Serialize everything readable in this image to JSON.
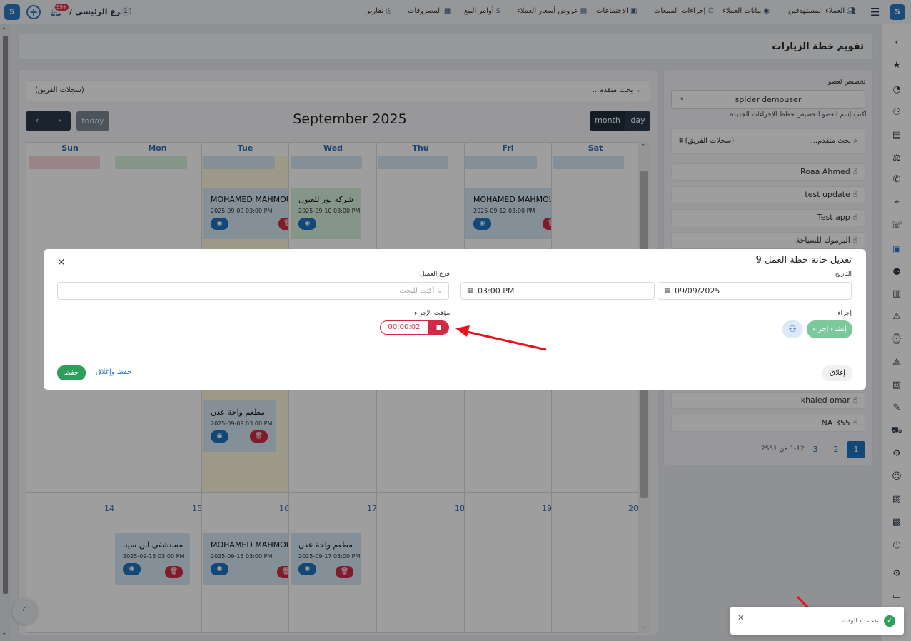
{
  "topbar": {
    "branch_label": "الفرع الرئيسي /",
    "branch_badge": "1",
    "notif_count": "99+",
    "nav": [
      {
        "label": "العملاء المستهدفين",
        "icon": "people-target-icon"
      },
      {
        "label": "بيانات العملاء",
        "icon": "customer-data-icon"
      },
      {
        "label": "إجراءات المبيعات",
        "icon": "phone-icon"
      },
      {
        "label": "الإجتماعات",
        "icon": "meeting-icon"
      },
      {
        "label": "عروض أسعار العملاء",
        "icon": "quote-icon"
      },
      {
        "label": "أوامر البيع",
        "icon": "sales-order-icon"
      },
      {
        "label": "المصروفات",
        "icon": "expenses-icon"
      },
      {
        "label": "تقارير",
        "icon": "reports-icon"
      }
    ]
  },
  "page": {
    "title": "تقويم خطة الزيارات"
  },
  "calendar": {
    "advanced_search": "بحث متقدم...",
    "team_records": "(سجلات الفريق)",
    "title": "September 2025",
    "today_label": "today",
    "month_label": "month",
    "day_label": "day",
    "weekdays": [
      "Sun",
      "Mon",
      "Tue",
      "Wed",
      "Thu",
      "Fri",
      "Sat"
    ],
    "week3_days": [
      "14",
      "15",
      "16",
      "17",
      "18",
      "19",
      "20"
    ],
    "events": [
      {
        "title": "MOHAMED MAHMOUD",
        "time": "2025-09-09 03:00 PM"
      },
      {
        "title": "شركة نور للعيون",
        "time": "2025-09-10 03:00 PM"
      },
      {
        "title": "MOHAMED MAHMOUD",
        "time": "2025-09-12 03:00 PM"
      },
      {
        "title": "مطعم واحة عدن",
        "time": "2025-09-09 03:00 PM"
      },
      {
        "title": "مستشفى ابن سينا",
        "time": "2025-09-15 03:00 PM"
      },
      {
        "title": "MOHAMED MAHMOUD",
        "time": "2025-09-16 03:00 PM"
      },
      {
        "title": "مطعم واحة عدن",
        "time": "2025-09-17 03:00 PM"
      }
    ]
  },
  "side": {
    "assign_label": "تخصيص لعضو",
    "member_value": "spider demouser",
    "hint": "أكتب إسم العضو لتخصيص خطط الإجراءات الجديدة",
    "advanced_search": "بحث متقدم...",
    "team_records": "(سجلات الفريق)",
    "members": [
      "Roaa Ahmed",
      "test update",
      "Test app",
      "اليرموك للسياحة",
      "khaled omar",
      "NA 355"
    ],
    "pager": {
      "p1": "1",
      "p2": "2",
      "p3": "3",
      "info": "1-12 من 2551"
    }
  },
  "modal": {
    "title": "تعديل خانة خطة العمل 9",
    "date_label": "التاريخ",
    "date_value": "09/09/2025",
    "time_value": "03:00 PM",
    "branch_label": "فرع العميل",
    "branch_placeholder": "أكتب للبحث",
    "action_label": "إجراء",
    "create_action": "إنشاء إجراء",
    "timer_label": "مؤقت الإجراء",
    "timer_value": "00:00:02",
    "close_label": "إغلاق",
    "save_close_label": "حفظ وإغلاق",
    "save_label": "حفظ"
  },
  "toast": {
    "message": "بدء عداد الوقت"
  },
  "colors": {
    "primary_blue": "#1e75c2",
    "dark_navy": "#2b3a4c",
    "danger": "#d02a45",
    "success": "#2e9e5b"
  }
}
